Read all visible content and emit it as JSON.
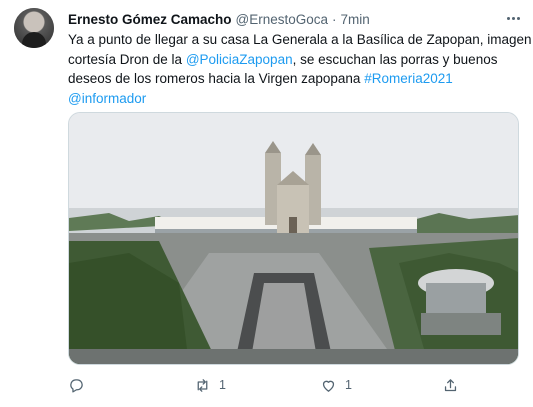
{
  "author": {
    "name": "Ernesto Gómez Camacho",
    "handle": "@ErnestoGoca",
    "separator": "·",
    "time": "7min"
  },
  "tweet_text": {
    "line1": "Ya a punto de llegar a su casa La Generala a la Basílica de Zapopan, imagen",
    "line2_prefix": "cortesía Dron de la ",
    "line2_mention": "@PoliciaZapopan",
    "line2_suffix": ", se escuchan las porras y buenos",
    "line3_text": "deseos de los romeros hacia la Virgen zapopana  ",
    "line3_hashtag": "#Romeria2021",
    "line4_mention": "@informador"
  },
  "actions": {
    "reply_count": "",
    "retweet_count": "1",
    "like_count": "1",
    "share_count": ""
  },
  "icons": [
    "more-options-icon",
    "reply-icon",
    "retweet-icon",
    "like-icon",
    "share-icon"
  ],
  "colors": {
    "link": "#1d9bf0",
    "secondary_text": "#536471",
    "border": "#cfd9de"
  }
}
